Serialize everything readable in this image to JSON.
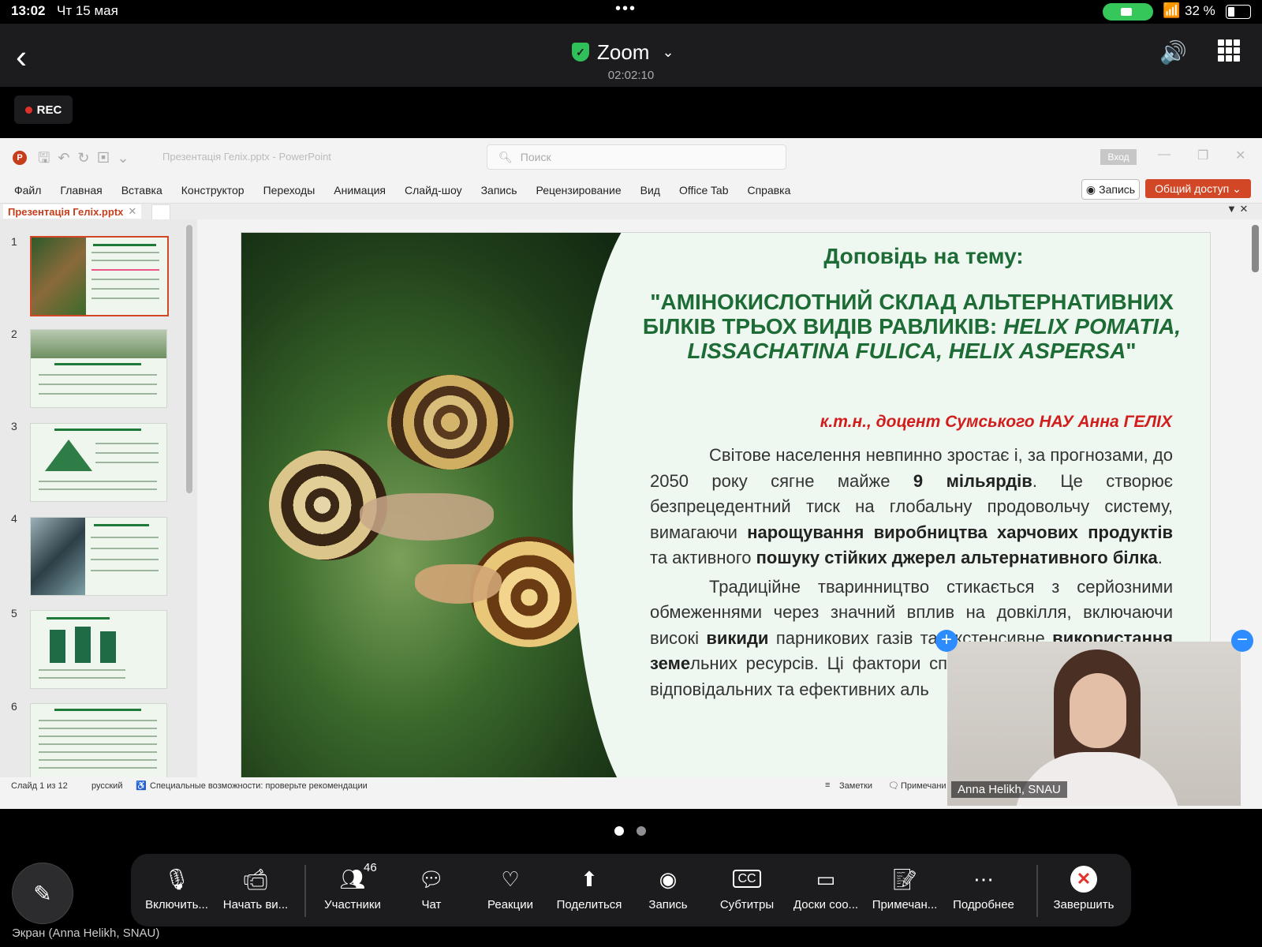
{
  "status_bar": {
    "time": "13:02",
    "date": "Чт 15 мая",
    "dots": "•••",
    "battery": "32 %"
  },
  "header": {
    "title": "Zoom",
    "elapsed": "02:02:10"
  },
  "rec_label": "REC",
  "powerpoint": {
    "doc_title": "Презентація Геліх.pptx  -  PowerPoint",
    "search_placeholder": "Поиск",
    "signin": "Вход",
    "ribbon": [
      "Файл",
      "Главная",
      "Вставка",
      "Конструктор",
      "Переходы",
      "Анимация",
      "Слайд-шоу",
      "Запись",
      "Рецензирование",
      "Вид",
      "Office Tab",
      "Справка"
    ],
    "record_button": "Запись",
    "share_button": "Общий доступ",
    "file_tab": "Презентація Геліх.pptx",
    "thumb_numbers": [
      "1",
      "2",
      "3",
      "4",
      "5",
      "6"
    ],
    "status_left": "Слайд 1 из 12",
    "status_lang": "русский",
    "status_access": "Специальные возможности: проверьте рекомендации",
    "status_notes": "Заметки",
    "status_comments": "Примечани"
  },
  "slide": {
    "heading": "Доповідь на тему:",
    "title_part1": "\"АМІНОКИСЛОТНИЙ СКЛАД АЛЬТЕРНАТИВНИХ БІЛКІВ ТРЬОХ ВИДІВ РАВЛИКІВ: ",
    "title_italic": "HELIX POMATIA, LISSACHATINA FULICA, HELIX ASPERSA",
    "title_end": "\"",
    "author": "к.т.н., доцент Сумського НАУ Анна ГЕЛІХ",
    "p1_a": "Світове населення невпинно зростає і, за прогнозами, до 2050 року сягне майже ",
    "p1_b": "9 мільярдів",
    "p1_c": ". Це створює безпрецедентний тиск на глобальну продовольчу систему, вимагаючи ",
    "p1_d": "нарощування виробництва харчових продуктів",
    "p1_e": " та активного ",
    "p1_f": "пошуку стійких джерел альтернативного білка",
    "p1_g": ".",
    "p2_a": "Традиційне тваринництво стикається з серйозними обмеженнями через значний вплив на довкілля, включаючи високі ",
    "p2_b": "викиди",
    "p2_c": " парникових газів та екстенсивне ",
    "p2_d": "використання земе",
    "p2_e": "льних ресурсів. Ці фактори спонукають до пошуку більш відповідальних та ефективних аль"
  },
  "video": {
    "name": "Anna Helikh, SNAU"
  },
  "toolbar": {
    "mic": "Включить...",
    "video": "Начать ви...",
    "participants": "Участники",
    "participants_count": "46",
    "chat": "Чат",
    "reactions": "Реакции",
    "share": "Поделиться",
    "record": "Запись",
    "subtitles": "Субтитры",
    "whiteboards": "Доски соо...",
    "notes": "Примечан...",
    "more": "Подробнее",
    "end": "Завершить"
  },
  "screen_label": "Экран (Anna Helikh, SNAU)",
  "colors": {
    "accent_green": "#1d6b35",
    "author_red": "#d21d1d",
    "ppt_orange": "#d24726",
    "zoom_blue": "#2d8cff"
  }
}
